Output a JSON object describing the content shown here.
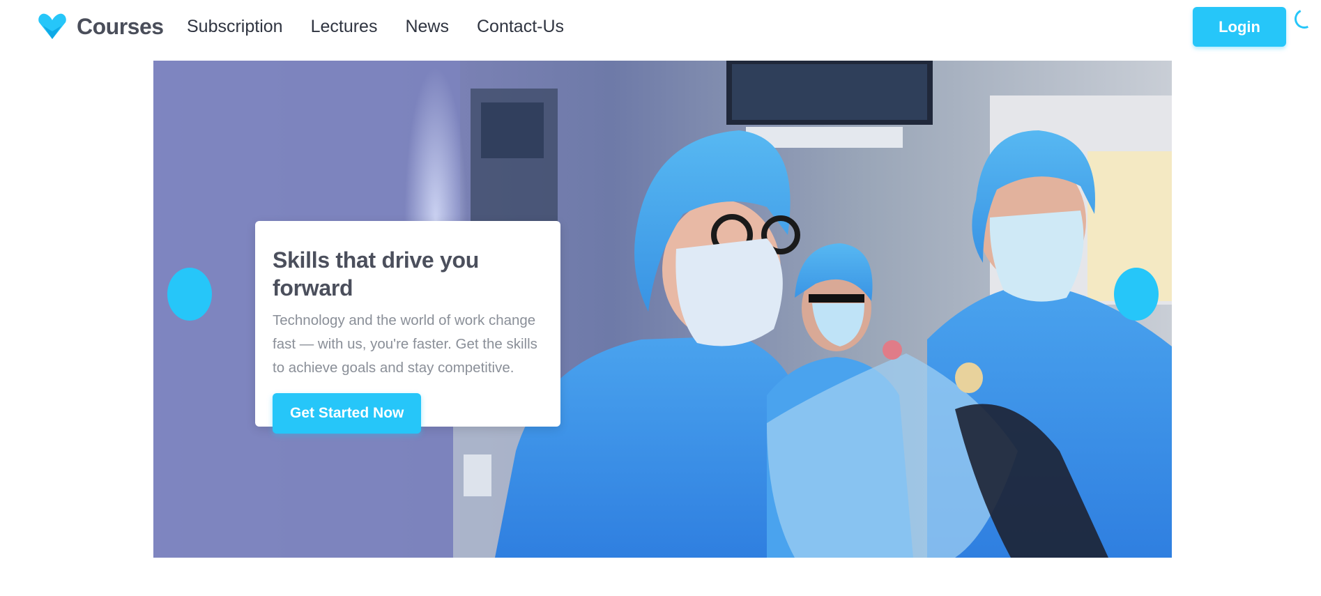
{
  "header": {
    "brand_name": "Courses",
    "nav": [
      "Subscription",
      "Lectures",
      "News",
      "Contact-Us"
    ],
    "login_label": "Login"
  },
  "hero": {
    "card": {
      "title": "Skills that drive you forward",
      "text": "Technology and the world of work change fast — with us, you're faster. Get the skills to achieve goals and stay competitive.",
      "cta_label": "Get Started Now"
    },
    "image_subject": "surgical team in operating room"
  },
  "colors": {
    "accent": "#26c6f9",
    "brand_text": "#4a4e5a",
    "nav_text": "#2f3440",
    "card_title": "#4b4f5c",
    "card_text": "#8a8f98"
  },
  "icons": [
    "brand-heart-logo-icon",
    "loading-spinner-icon",
    "carousel-prev-icon",
    "carousel-next-icon"
  ]
}
